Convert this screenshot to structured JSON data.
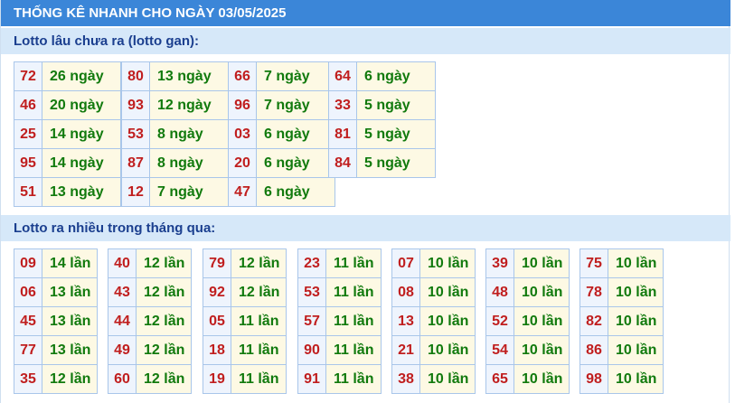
{
  "title": "THỐNG KÊ NHANH CHO NGÀY 03/05/2025",
  "section_gan": {
    "label": "Lotto lâu chưa ra (lotto gan):",
    "columns": [
      [
        [
          "72",
          "26 ngày"
        ],
        [
          "46",
          "20 ngày"
        ],
        [
          "25",
          "14 ngày"
        ],
        [
          "95",
          "14 ngày"
        ],
        [
          "51",
          "13 ngày"
        ]
      ],
      [
        [
          "80",
          "13 ngày"
        ],
        [
          "93",
          "12 ngày"
        ],
        [
          "53",
          "8 ngày"
        ],
        [
          "87",
          "8 ngày"
        ],
        [
          "12",
          "7 ngày"
        ]
      ],
      [
        [
          "66",
          "7 ngày"
        ],
        [
          "96",
          "7 ngày"
        ],
        [
          "03",
          "6 ngày"
        ],
        [
          "20",
          "6 ngày"
        ],
        [
          "47",
          "6 ngày"
        ]
      ],
      [
        [
          "64",
          "6 ngày"
        ],
        [
          "33",
          "5 ngày"
        ],
        [
          "81",
          "5 ngày"
        ],
        [
          "84",
          "5 ngày"
        ]
      ]
    ]
  },
  "section_nhieu": {
    "label": "Lotto ra nhiều trong tháng qua:",
    "columns": [
      [
        [
          "09",
          "14 lần"
        ],
        [
          "06",
          "13 lần"
        ],
        [
          "45",
          "13 lần"
        ],
        [
          "77",
          "13 lần"
        ],
        [
          "35",
          "12 lần"
        ]
      ],
      [
        [
          "40",
          "12 lần"
        ],
        [
          "43",
          "12 lần"
        ],
        [
          "44",
          "12 lần"
        ],
        [
          "49",
          "12 lần"
        ],
        [
          "60",
          "12 lần"
        ]
      ],
      [
        [
          "79",
          "12 lần"
        ],
        [
          "92",
          "12 lần"
        ],
        [
          "05",
          "11 lần"
        ],
        [
          "18",
          "11 lần"
        ],
        [
          "19",
          "11 lần"
        ]
      ],
      [
        [
          "23",
          "11 lần"
        ],
        [
          "53",
          "11 lần"
        ],
        [
          "57",
          "11 lần"
        ],
        [
          "90",
          "11 lần"
        ],
        [
          "91",
          "11 lần"
        ]
      ],
      [
        [
          "07",
          "10 lần"
        ],
        [
          "08",
          "10 lần"
        ],
        [
          "13",
          "10 lần"
        ],
        [
          "21",
          "10 lần"
        ],
        [
          "38",
          "10 lần"
        ]
      ],
      [
        [
          "39",
          "10 lần"
        ],
        [
          "48",
          "10 lần"
        ],
        [
          "52",
          "10 lần"
        ],
        [
          "54",
          "10 lần"
        ],
        [
          "65",
          "10 lần"
        ]
      ],
      [
        [
          "75",
          "10 lần"
        ],
        [
          "78",
          "10 lần"
        ],
        [
          "82",
          "10 lần"
        ],
        [
          "86",
          "10 lần"
        ],
        [
          "98",
          "10 lần"
        ]
      ]
    ]
  }
}
